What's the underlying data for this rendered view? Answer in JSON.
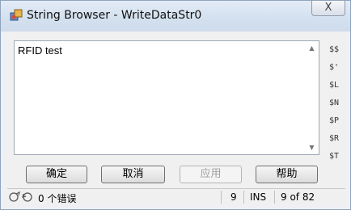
{
  "window": {
    "title": "String Browser - WriteDataStr0",
    "close_label": "X"
  },
  "editor": {
    "value": "RFID test"
  },
  "escape_codes": [
    "$$",
    "$'",
    "$L",
    "$N",
    "$P",
    "$R",
    "$T"
  ],
  "buttons": {
    "ok": "确定",
    "cancel": "取消",
    "apply": "应用",
    "help": "帮助"
  },
  "status": {
    "errors": "0 个错误",
    "line": "9",
    "mode": "INS",
    "position": "9 of 82"
  },
  "icons": {
    "title": "app-icon",
    "status_left": "goto-error-icon",
    "status_right": "refresh-errors-icon"
  }
}
